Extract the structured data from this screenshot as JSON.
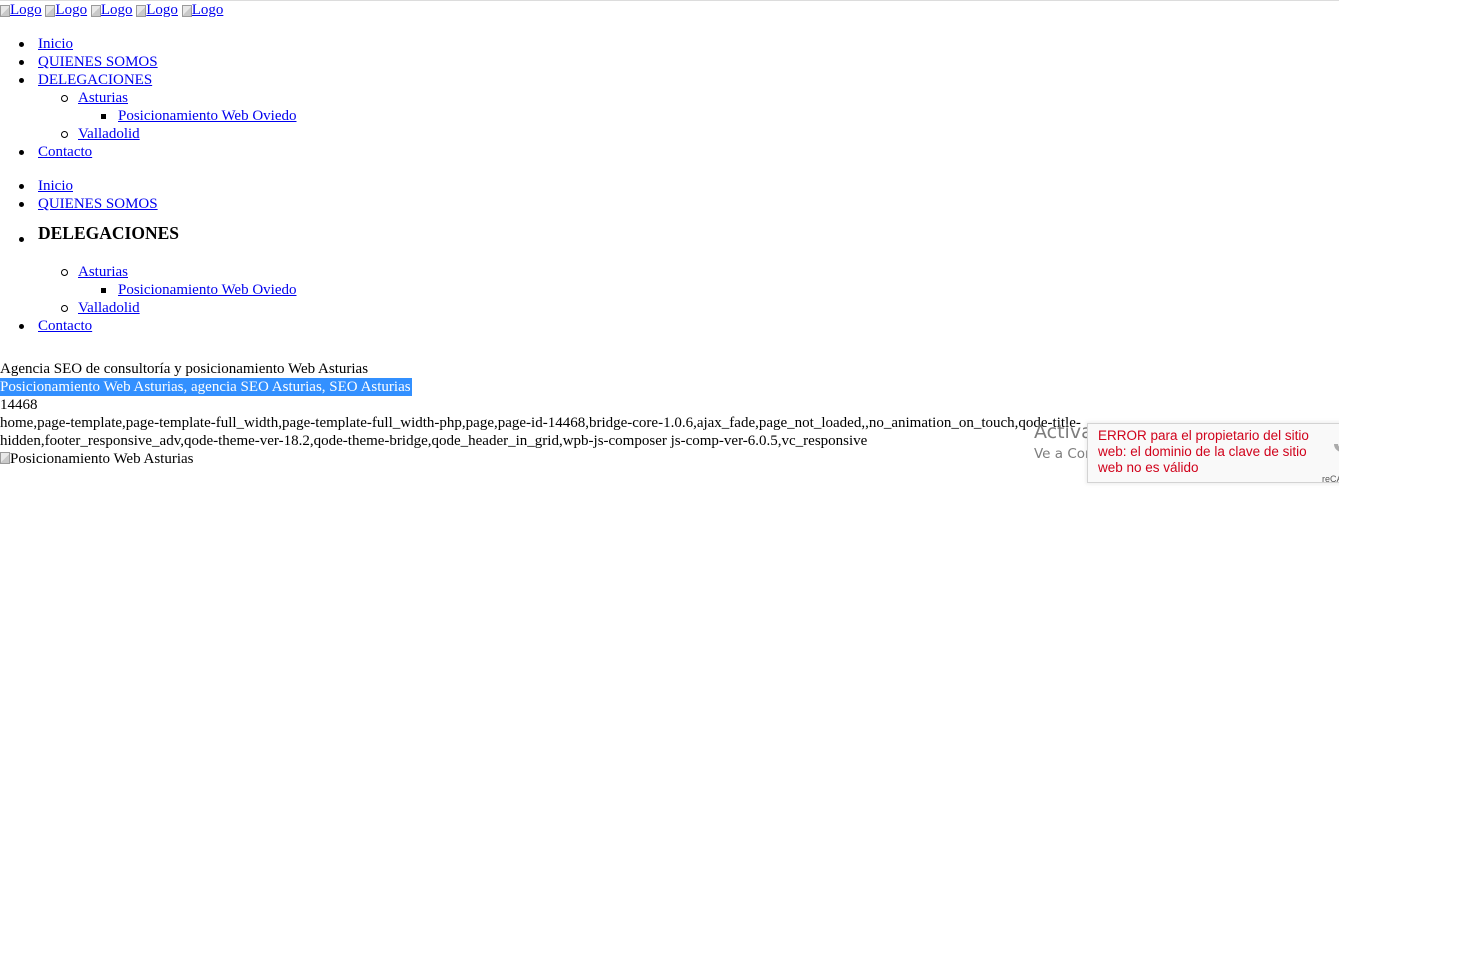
{
  "logos": [
    {
      "alt": "Logo"
    },
    {
      "alt": "Logo"
    },
    {
      "alt": "Logo"
    },
    {
      "alt": "Logo"
    },
    {
      "alt": "Logo"
    }
  ],
  "menu_primary": {
    "inicio": "Inicio",
    "quienes": "QUIENES SOMOS",
    "delegaciones": "DELEGACIONES",
    "asturias": "Asturias",
    "oviedo": "Posicionamiento Web Oviedo",
    "valladolid": "Valladolid",
    "contacto": "Contacto"
  },
  "menu_mobile": {
    "inicio": "Inicio",
    "quienes": "QUIENES SOMOS",
    "delegaciones": "DELEGACIONES",
    "asturias": "Asturias",
    "oviedo": "Posicionamiento Web Oviedo",
    "valladolid": "Valladolid",
    "contacto": "Contacto"
  },
  "page": {
    "tagline": "Agencia SEO de consultoría y posicionamiento Web Asturias",
    "selected_title": "Posicionamiento Web Asturias, agencia SEO Asturias, SEO Asturias",
    "page_id": "14468",
    "body_classes": "home,page-template,page-template-full_width,page-template-full_width-php,page,page-id-14468,bridge-core-1.0.6,ajax_fade,page_not_loaded,,no_animation_on_touch,qode-title-hidden,footer_responsive_adv,qode-theme-ver-18.2,qode-theme-bridge,qode_header_in_grid,wpb-js-composer js-comp-ver-6.0.5,vc_responsive",
    "hero_alt": "Posicionamiento Web Asturias"
  },
  "windows_watermark": {
    "title": "Activar Windows",
    "subtitle": "Ve a Configuración para activar Windows."
  },
  "recaptcha": {
    "error": "ERROR para el propietario del sitio web: el dominio de la clave de sitio web no es válido",
    "brand": "reCAPTCHA"
  },
  "colors": {
    "link": "#0000ee",
    "selection": "#3390ff",
    "error": "#d0021b"
  }
}
